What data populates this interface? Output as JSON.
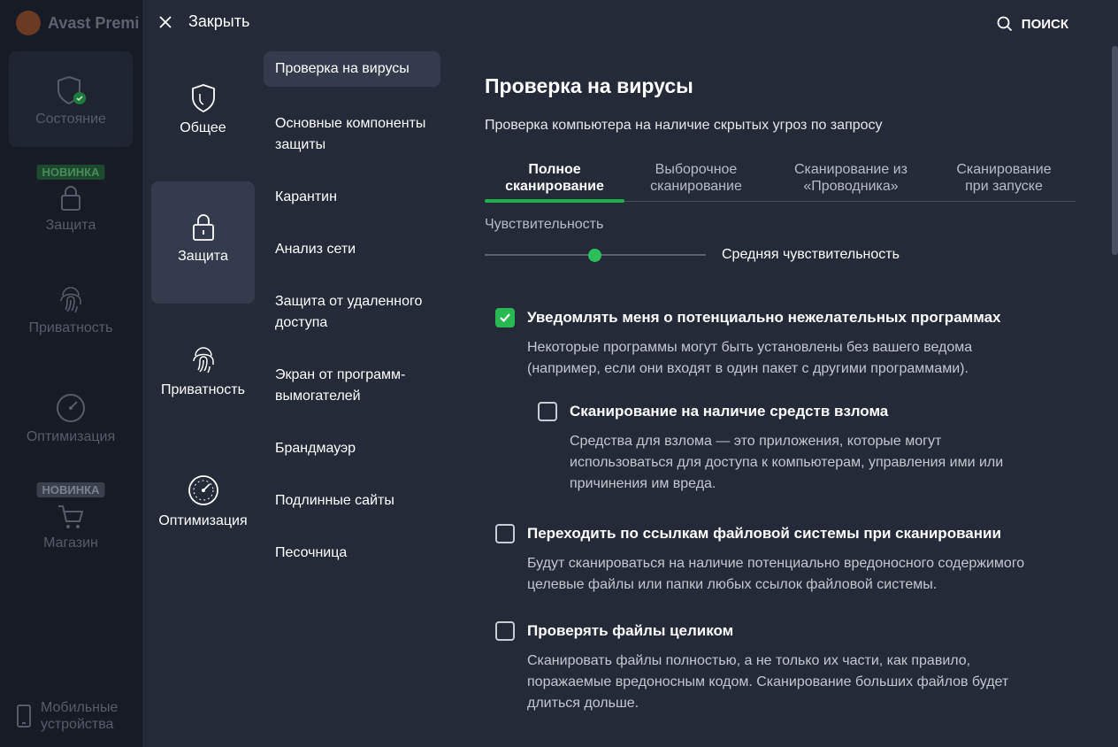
{
  "app": {
    "title": "Avast Premi",
    "sidebar": [
      {
        "label": "Состояние",
        "icon": "shield-check-icon"
      },
      {
        "label": "Защита",
        "icon": "lock-icon",
        "badge": "НОВИНКА"
      },
      {
        "label": "Приватность",
        "icon": "fingerprint-icon"
      },
      {
        "label": "Оптимизация",
        "icon": "speedometer-icon"
      },
      {
        "label": "Магазин",
        "icon": "cart-icon",
        "badge": "НОВИНКА"
      }
    ],
    "mobile": {
      "line1": "Мобильные",
      "line2": "устройства"
    }
  },
  "header": {
    "close_label": "Закрыть",
    "search_label": "ПОИСК"
  },
  "categories": [
    {
      "label": "Общее",
      "icon": "shield-icon"
    },
    {
      "label": "Защита",
      "icon": "lock-icon"
    },
    {
      "label": "Приватность",
      "icon": "fingerprint-icon"
    },
    {
      "label": "Оптимизация",
      "icon": "speedometer-icon"
    }
  ],
  "subnav": [
    {
      "label": "Проверка на вирусы"
    },
    {
      "label": "Основные компоненты защиты"
    },
    {
      "label": "Карантин"
    },
    {
      "label": "Анализ сети"
    },
    {
      "label": "Защита от удаленного доступа"
    },
    {
      "label": "Экран от программ-вымогателей"
    },
    {
      "label": "Брандмауэр"
    },
    {
      "label": "Подлинные сайты"
    },
    {
      "label": "Песочница"
    }
  ],
  "main": {
    "title": "Проверка на вирусы",
    "description": "Проверка компьютера на наличие скрытых угроз по запросу",
    "tabs": [
      {
        "l1": "Полное",
        "l2": "сканирование"
      },
      {
        "l1": "Выборочное",
        "l2": "сканирование"
      },
      {
        "l1": "Сканирование из",
        "l2": "«Проводника»"
      },
      {
        "l1": "Сканирование",
        "l2": "при запуске"
      }
    ],
    "sensitivity": {
      "label": "Чувствительность",
      "value": "Средняя чувствительность",
      "level": 0.5
    },
    "options": [
      {
        "title": "Уведомлять меня о потенциально нежелательных программах",
        "checked": true,
        "desc": [
          "Некоторые программы могут быть установлены без вашего ведома",
          "(например, если они входят в один пакет с другими программами)."
        ]
      },
      {
        "title": "Сканирование на наличие средств взлома",
        "checked": false,
        "desc": [
          "Средства для взлома — это приложения, которые могут",
          "использоваться для доступа к компьютерам, управления ими или",
          "причинения им вреда."
        ]
      },
      {
        "title": "Переходить по ссылкам файловой системы при сканировании",
        "checked": false,
        "desc": [
          "Будут сканироваться на наличие потенциально вредоносного содержимого",
          "целевые файлы или папки любых ссылок файловой системы."
        ]
      },
      {
        "title": "Проверять файлы целиком",
        "checked": false,
        "desc": [
          "Сканировать файлы полностью, а не только их части, как правило,",
          "поражаемые вредоносным кодом. Сканирование больших файлов будет",
          "длиться дольше."
        ]
      }
    ]
  }
}
